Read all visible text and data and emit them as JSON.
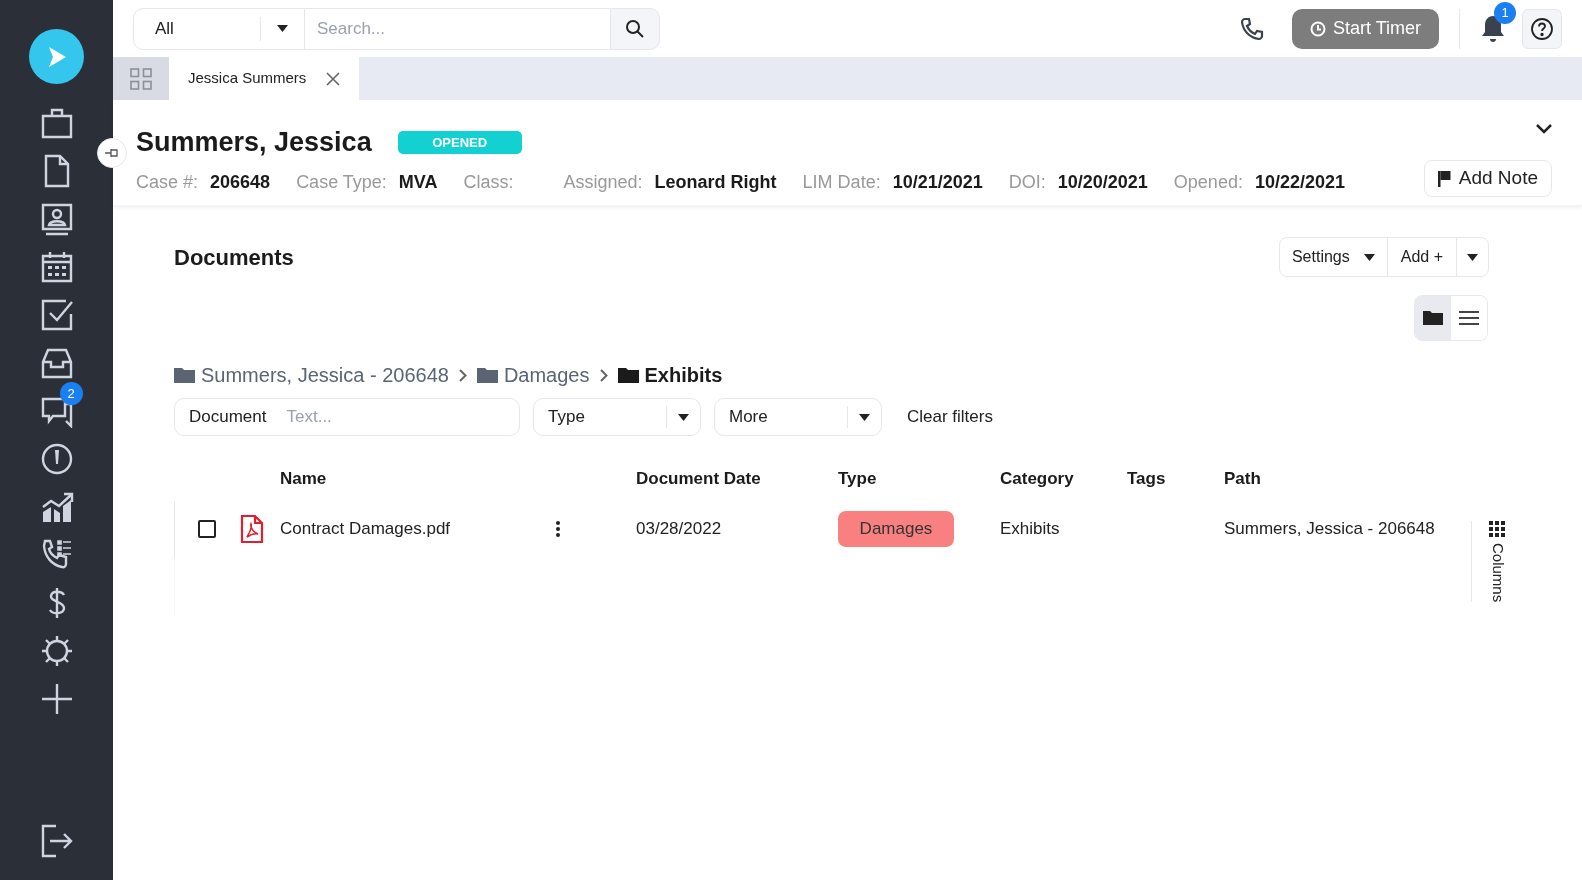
{
  "sidebar": {
    "messages_badge": "2"
  },
  "topbar": {
    "scope": "All",
    "search_placeholder": "Search...",
    "timer": "Start Timer",
    "notification_count": "1"
  },
  "tabs": [
    {
      "label": "Jessica Summers",
      "selected": true
    }
  ],
  "case": {
    "name": "Summers, Jessica",
    "status": "OPENED",
    "fields": [
      {
        "label": "Case #:",
        "value": "206648"
      },
      {
        "label": "Case Type:",
        "value": "MVA"
      },
      {
        "label": "Class:"
      },
      {
        "label": "Assigned:",
        "value": "Leonard Right"
      },
      {
        "label": "LIM Date:",
        "value": "10/21/2021"
      },
      {
        "label": "DOI:",
        "value": "10/20/2021"
      },
      {
        "label": "Opened:",
        "value": "10/22/2021"
      }
    ],
    "add_note": "Add Note"
  },
  "documents": {
    "title": "Documents",
    "settings": "Settings",
    "add": "Add +",
    "view_modes": [
      {
        "selected": true
      },
      {
        "selected": false
      }
    ],
    "breadcrumbs": [
      {
        "label": "Summers, Jessica - 206648",
        "current": false
      },
      {
        "label": "Damages",
        "current": false
      },
      {
        "label": "Exhibits",
        "current": true
      }
    ],
    "filters": {
      "document_label": "Document",
      "document_placeholder": "Text...",
      "type": "Type",
      "more": "More",
      "clear": "Clear filters"
    },
    "columns": [
      "Name",
      "Document Date",
      "Type",
      "Category",
      "Tags",
      "Path"
    ],
    "rows": [
      {
        "checked": false,
        "name": "Contract Damages.pdf",
        "date": "03/28/2022",
        "type": "Damages",
        "color": "#f98080",
        "category": "Exhibits",
        "path": "Summers, Jessica - 206648"
      }
    ],
    "columns_toggle": "Columns"
  }
}
